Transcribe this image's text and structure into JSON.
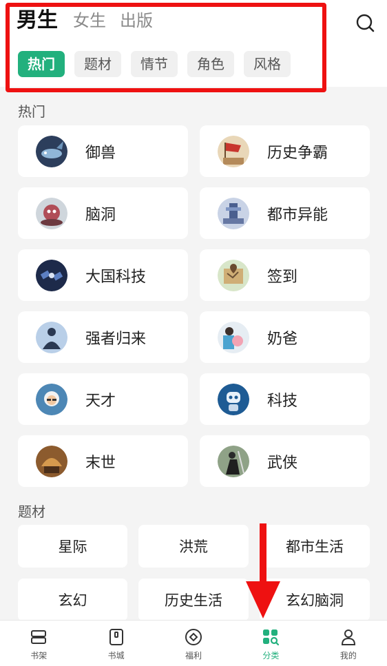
{
  "top_tabs": [
    {
      "label": "男生",
      "active": true
    },
    {
      "label": "女生",
      "active": false
    },
    {
      "label": "出版",
      "active": false
    }
  ],
  "filter_chips": [
    {
      "label": "热门",
      "active": true
    },
    {
      "label": "题材",
      "active": false
    },
    {
      "label": "情节",
      "active": false
    },
    {
      "label": "角色",
      "active": false
    },
    {
      "label": "风格",
      "active": false
    }
  ],
  "sections": {
    "hot": {
      "title": "热门",
      "items": [
        {
          "label": "御兽",
          "icon": "whale-icon"
        },
        {
          "label": "历史争霸",
          "icon": "war-flag-icon"
        },
        {
          "label": "脑洞",
          "icon": "brain-monster-icon"
        },
        {
          "label": "都市异能",
          "icon": "city-tower-icon"
        },
        {
          "label": "大国科技",
          "icon": "satellite-icon"
        },
        {
          "label": "签到",
          "icon": "treasure-map-icon"
        },
        {
          "label": "强者归来",
          "icon": "hero-return-icon"
        },
        {
          "label": "奶爸",
          "icon": "dad-baby-icon"
        },
        {
          "label": "天才",
          "icon": "genius-icon"
        },
        {
          "label": "科技",
          "icon": "robot-icon"
        },
        {
          "label": "末世",
          "icon": "apocalypse-icon"
        },
        {
          "label": "武侠",
          "icon": "swordsman-icon"
        }
      ]
    },
    "theme": {
      "title": "题材",
      "items": [
        "星际",
        "洪荒",
        "都市生活",
        "玄幻",
        "历史生活",
        "玄幻脑洞"
      ]
    }
  },
  "bottom_nav": [
    {
      "label": "书架",
      "icon": "bookshelf-icon",
      "active": false
    },
    {
      "label": "书城",
      "icon": "bookstore-icon",
      "active": false
    },
    {
      "label": "福利",
      "icon": "welfare-icon",
      "active": false
    },
    {
      "label": "分类",
      "icon": "category-icon",
      "active": true
    },
    {
      "label": "我的",
      "icon": "profile-icon",
      "active": false
    }
  ],
  "colors": {
    "accent": "#22b07d",
    "highlight": "#ee1111"
  }
}
